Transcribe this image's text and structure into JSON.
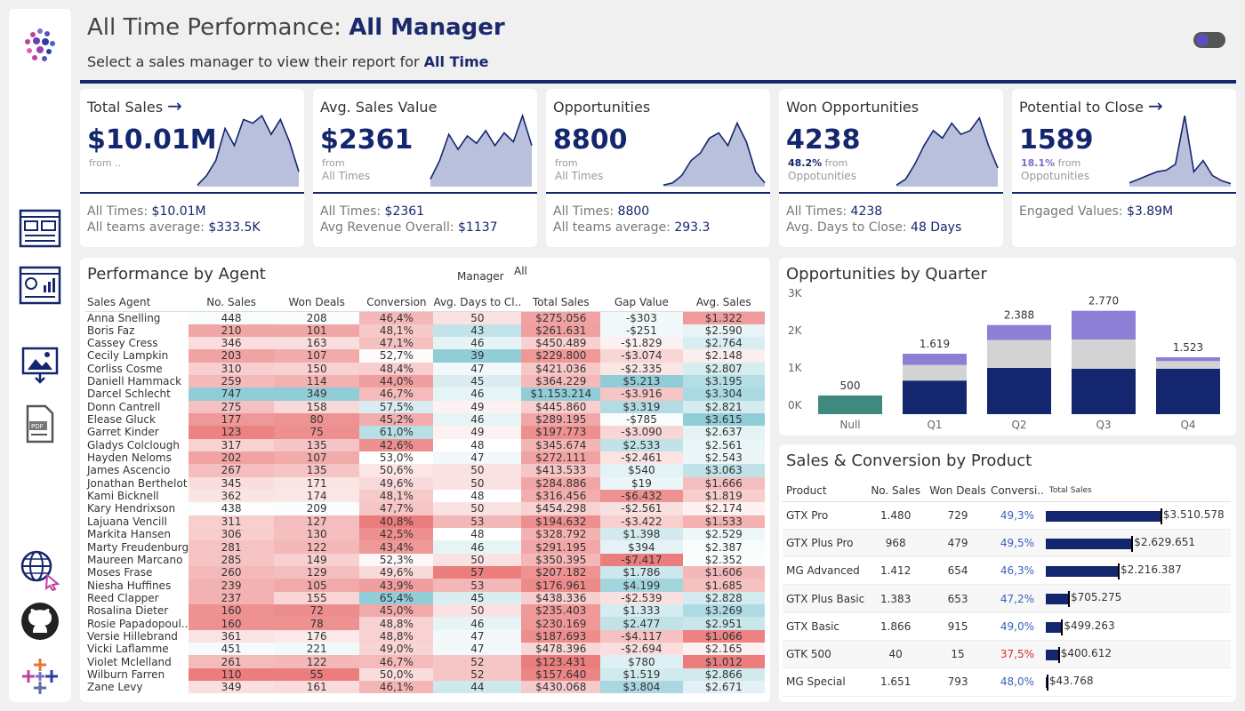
{
  "header": {
    "title_prefix": "All Time Performance: ",
    "title_value": "All Manager",
    "subtitle_prefix": "Select a sales manager to view their report for ",
    "subtitle_value": "All Time"
  },
  "kpis": [
    {
      "title": "Total Sales",
      "arrow": "→",
      "value": "$10.01M",
      "note_strong": "",
      "note1": "from ..",
      "note2": "",
      "f1_label": "All Times: ",
      "f1_value": "$10.01M",
      "f2_label": "All teams average: ",
      "f2_value": "$333.5K",
      "spark": [
        0.02,
        0.15,
        0.35,
        0.78,
        0.55,
        0.9,
        0.85,
        0.95,
        0.7,
        0.9,
        0.6,
        0.2
      ],
      "strong_color": ""
    },
    {
      "title": "Avg. Sales Value",
      "arrow": "",
      "value": "$2361",
      "note_strong": "",
      "note1": "from",
      "note2": "All Times",
      "f1_label": "All Times: ",
      "f1_value": "$2361",
      "f2_label": "Avg Revenue Overall: ",
      "f2_value": "$1137",
      "spark": [
        0.1,
        0.35,
        0.7,
        0.5,
        0.68,
        0.58,
        0.75,
        0.55,
        0.72,
        0.6,
        0.95,
        0.55
      ],
      "strong_color": ""
    },
    {
      "title": "Opportunities",
      "arrow": "",
      "value": "8800",
      "note_strong": "",
      "note1": "from",
      "note2": "All Times",
      "f1_label": "All Times: ",
      "f1_value": "8800",
      "f2_label": "All teams average: ",
      "f2_value": "293.3",
      "spark": [
        0.02,
        0.05,
        0.15,
        0.35,
        0.45,
        0.65,
        0.72,
        0.55,
        0.85,
        0.6,
        0.2,
        0.05
      ],
      "strong_color": ""
    },
    {
      "title": "Won Opportunities",
      "arrow": "",
      "value": "4238",
      "note_strong": "48.2%",
      "note1": " from",
      "note2": "Oppotunities",
      "f1_label": "All Times: ",
      "f1_value": "4238",
      "f2_label": "Avg. Days to Close: ",
      "f2_value": "48 Days",
      "spark": [
        0.02,
        0.1,
        0.3,
        0.55,
        0.75,
        0.65,
        0.85,
        0.7,
        0.75,
        0.92,
        0.55,
        0.25
      ],
      "strong_color": "#14266e"
    },
    {
      "title": "Potential to Close",
      "arrow": "→",
      "value": "1589",
      "note_strong": "18.1%",
      "note1": " from",
      "note2": "Oppotunities",
      "f1_label": "Engaged Values: ",
      "f1_value": "$3.89M",
      "f2_label": "",
      "f2_value": "",
      "spark": [
        0.05,
        0.1,
        0.15,
        0.2,
        0.22,
        0.3,
        0.95,
        0.2,
        0.35,
        0.15,
        0.08,
        0.04
      ],
      "strong_color": "#7b6fd0"
    }
  ],
  "agents": {
    "title": "Performance by Agent",
    "filter_label": "Manager",
    "filter_value": "All",
    "columns": [
      "Sales Agent",
      "No. Sales",
      "Won Deals",
      "Conversion",
      "Avg. Days to Cl..",
      "Total Sales",
      "Gap Value",
      "Avg. Sales"
    ],
    "rows": [
      [
        "Anna Snelling",
        "448",
        "208",
        "46,4%",
        "50",
        "$275.056",
        "-$303",
        "$1.322"
      ],
      [
        "Boris Faz",
        "210",
        "101",
        "48,1%",
        "43",
        "$261.631",
        "-$251",
        "$2.590"
      ],
      [
        "Cassey Cress",
        "346",
        "163",
        "47,1%",
        "46",
        "$450.489",
        "-$1.829",
        "$2.764"
      ],
      [
        "Cecily Lampkin",
        "203",
        "107",
        "52,7%",
        "39",
        "$229.800",
        "-$3.074",
        "$2.148"
      ],
      [
        "Corliss Cosme",
        "310",
        "150",
        "48,4%",
        "47",
        "$421.036",
        "-$2.335",
        "$2.807"
      ],
      [
        "Daniell Hammack",
        "259",
        "114",
        "44,0%",
        "45",
        "$364.229",
        "$5.213",
        "$3.195"
      ],
      [
        "Darcel Schlecht",
        "747",
        "349",
        "46,7%",
        "46",
        "$1.153.214",
        "-$3.916",
        "$3.304"
      ],
      [
        "Donn Cantrell",
        "275",
        "158",
        "57,5%",
        "49",
        "$445.860",
        "$3.319",
        "$2.821"
      ],
      [
        "Elease Gluck",
        "177",
        "80",
        "45,2%",
        "46",
        "$289.195",
        "-$785",
        "$3.615"
      ],
      [
        "Garret Kinder",
        "123",
        "75",
        "61,0%",
        "49",
        "$197.773",
        "-$3.090",
        "$2.637"
      ],
      [
        "Gladys Colclough",
        "317",
        "135",
        "42,6%",
        "48",
        "$345.674",
        "$2.533",
        "$2.561"
      ],
      [
        "Hayden Neloms",
        "202",
        "107",
        "53,0%",
        "47",
        "$272.111",
        "-$2.461",
        "$2.543"
      ],
      [
        "James Ascencio",
        "267",
        "135",
        "50,6%",
        "50",
        "$413.533",
        "$540",
        "$3.063"
      ],
      [
        "Jonathan Berthelot",
        "345",
        "171",
        "49,6%",
        "50",
        "$284.886",
        "$19",
        "$1.666"
      ],
      [
        "Kami Bicknell",
        "362",
        "174",
        "48,1%",
        "48",
        "$316.456",
        "-$6.432",
        "$1.819"
      ],
      [
        "Kary Hendrixson",
        "438",
        "209",
        "47,7%",
        "50",
        "$454.298",
        "-$2.561",
        "$2.174"
      ],
      [
        "Lajuana Vencill",
        "311",
        "127",
        "40,8%",
        "53",
        "$194.632",
        "-$3.422",
        "$1.533"
      ],
      [
        "Markita Hansen",
        "306",
        "130",
        "42,5%",
        "48",
        "$328.792",
        "$1.398",
        "$2.529"
      ],
      [
        "Marty Freudenburg",
        "281",
        "122",
        "43,4%",
        "46",
        "$291.195",
        "$394",
        "$2.387"
      ],
      [
        "Maureen Marcano",
        "285",
        "149",
        "52,3%",
        "50",
        "$350.395",
        "-$7.417",
        "$2.352"
      ],
      [
        "Moses Frase",
        "260",
        "129",
        "49,6%",
        "57",
        "$207.182",
        "$1.786",
        "$1.606"
      ],
      [
        "Niesha Huffines",
        "239",
        "105",
        "43,9%",
        "53",
        "$176.961",
        "$4.199",
        "$1.685"
      ],
      [
        "Reed Clapper",
        "237",
        "155",
        "65,4%",
        "45",
        "$438.336",
        "-$2.539",
        "$2.828"
      ],
      [
        "Rosalina Dieter",
        "160",
        "72",
        "45,0%",
        "50",
        "$235.403",
        "$1.333",
        "$3.269"
      ],
      [
        "Rosie Papadopoul..",
        "160",
        "78",
        "48,8%",
        "46",
        "$230.169",
        "$2.477",
        "$2.951"
      ],
      [
        "Versie Hillebrand",
        "361",
        "176",
        "48,8%",
        "47",
        "$187.693",
        "-$4.117",
        "$1.066"
      ],
      [
        "Vicki Laflamme",
        "451",
        "221",
        "49,0%",
        "47",
        "$478.396",
        "-$2.694",
        "$2.165"
      ],
      [
        "Violet Mclelland",
        "261",
        "122",
        "46,7%",
        "52",
        "$123.431",
        "$780",
        "$1.012"
      ],
      [
        "Wilburn Farren",
        "110",
        "55",
        "50,0%",
        "52",
        "$157.640",
        "$1.519",
        "$2.866"
      ],
      [
        "Zane Levy",
        "349",
        "161",
        "46,1%",
        "44",
        "$430.068",
        "$3.804",
        "$2.671"
      ]
    ]
  },
  "quarters": {
    "title": "Opportunities by Quarter",
    "y_ticks": [
      "0K",
      "1K",
      "2K",
      "3K"
    ],
    "bars": [
      {
        "label": "Null",
        "total": "500",
        "won": 0,
        "mid": 0,
        "top": 0,
        "single": 500
      },
      {
        "label": "Q1",
        "total": "1.619",
        "won": 900,
        "mid": 420,
        "top": 299,
        "single": 0
      },
      {
        "label": "Q2",
        "total": "2.388",
        "won": 1240,
        "mid": 748,
        "top": 400,
        "single": 0
      },
      {
        "label": "Q3",
        "total": "2.770",
        "won": 1220,
        "mid": 780,
        "top": 770,
        "single": 0
      },
      {
        "label": "Q4",
        "total": "1.523",
        "won": 1220,
        "mid": 200,
        "top": 103,
        "single": 0
      }
    ],
    "colors": {
      "won": "#14266e",
      "mid": "#d3d3d3",
      "top": "#8d7fd6",
      "single": "#3e8a7e"
    }
  },
  "products": {
    "title": "Sales & Conversion by Product",
    "columns": [
      "Product",
      "No. Sales",
      "Won Deals",
      "Conversi..",
      "Total Sales"
    ],
    "rows": [
      {
        "name": "GTX Pro",
        "sales": "1.480",
        "won": "729",
        "conv": "49,3%",
        "total": "$3.510.578",
        "value": 3510578,
        "conv_color": "#3a5fc0"
      },
      {
        "name": "GTX Plus Pro",
        "sales": "968",
        "won": "479",
        "conv": "49,5%",
        "total": "$2.629.651",
        "value": 2629651,
        "conv_color": "#3a5fc0"
      },
      {
        "name": "MG Advanced",
        "sales": "1.412",
        "won": "654",
        "conv": "46,3%",
        "total": "$2.216.387",
        "value": 2216387,
        "conv_color": "#3a5fc0"
      },
      {
        "name": "GTX Plus Basic",
        "sales": "1.383",
        "won": "653",
        "conv": "47,2%",
        "total": "$705.275",
        "value": 705275,
        "conv_color": "#3a5fc0"
      },
      {
        "name": "GTX Basic",
        "sales": "1.866",
        "won": "915",
        "conv": "49,0%",
        "total": "$499.263",
        "value": 499263,
        "conv_color": "#3a5fc0"
      },
      {
        "name": "GTK 500",
        "sales": "40",
        "won": "15",
        "conv": "37,5%",
        "total": "$400.612",
        "value": 400612,
        "conv_color": "#d03030"
      },
      {
        "name": "MG Special",
        "sales": "1.651",
        "won": "793",
        "conv": "48,0%",
        "total": "$43.768",
        "value": 43768,
        "conv_color": "#3a5fc0"
      }
    ]
  },
  "sidebar": {
    "icons": [
      "logo-icon",
      "dashboard-icon",
      "analytics-icon",
      "download-image-icon",
      "pdf-icon",
      "web-icon",
      "github-icon",
      "tableau-icon"
    ]
  }
}
